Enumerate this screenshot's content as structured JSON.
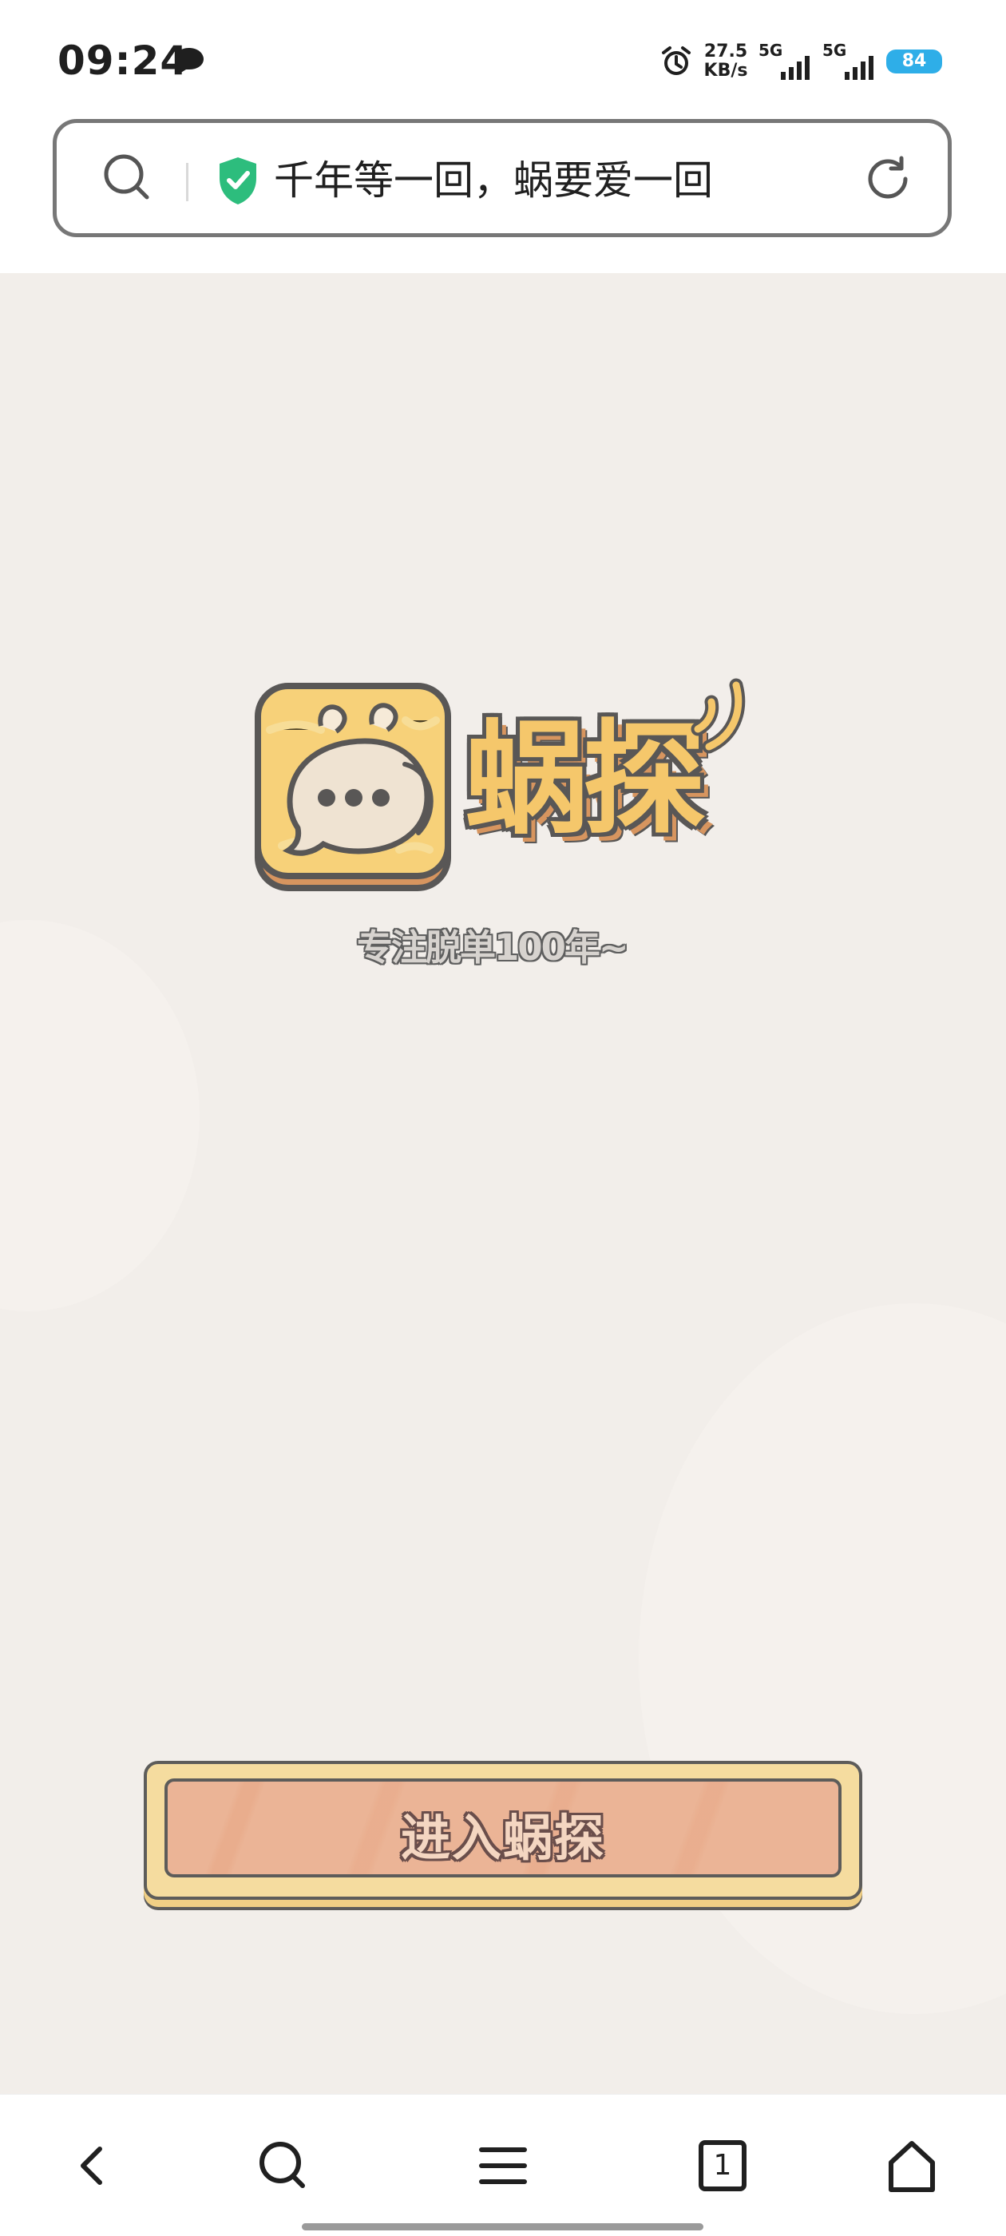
{
  "status_bar": {
    "time": "09:24",
    "network_speed": {
      "value": "27.5",
      "unit": "KB/s"
    },
    "signals": [
      {
        "label": "5G"
      },
      {
        "label": "5G"
      }
    ],
    "battery": "84",
    "icons": [
      "chat-bubble-icon",
      "alarm-clock-icon",
      "signal-icon",
      "battery-icon"
    ]
  },
  "address_bar": {
    "title": "千年等一回，蜗要爱一回",
    "icons": [
      "search-icon",
      "security-shield-icon",
      "refresh-icon"
    ]
  },
  "app": {
    "name": "蜗探",
    "slogan": "专注脱单100年~",
    "enter_button": "进入蜗探"
  },
  "bottom_nav": {
    "tab_count": "1",
    "items": [
      {
        "name": "back",
        "icon": "back-chevron-icon"
      },
      {
        "name": "search",
        "icon": "search-icon"
      },
      {
        "name": "menu",
        "icon": "menu-icon"
      },
      {
        "name": "tabs",
        "icon": "tab-count-icon"
      },
      {
        "name": "home",
        "icon": "home-icon"
      }
    ]
  },
  "colors": {
    "content_background": "#f2eeea",
    "button_fill": "#ebb496",
    "button_frame": "#f5dc9f",
    "logo_yellow": "#f5c76b",
    "battery_blue": "#2eaee8",
    "secure_green": "#2dbd7d"
  }
}
